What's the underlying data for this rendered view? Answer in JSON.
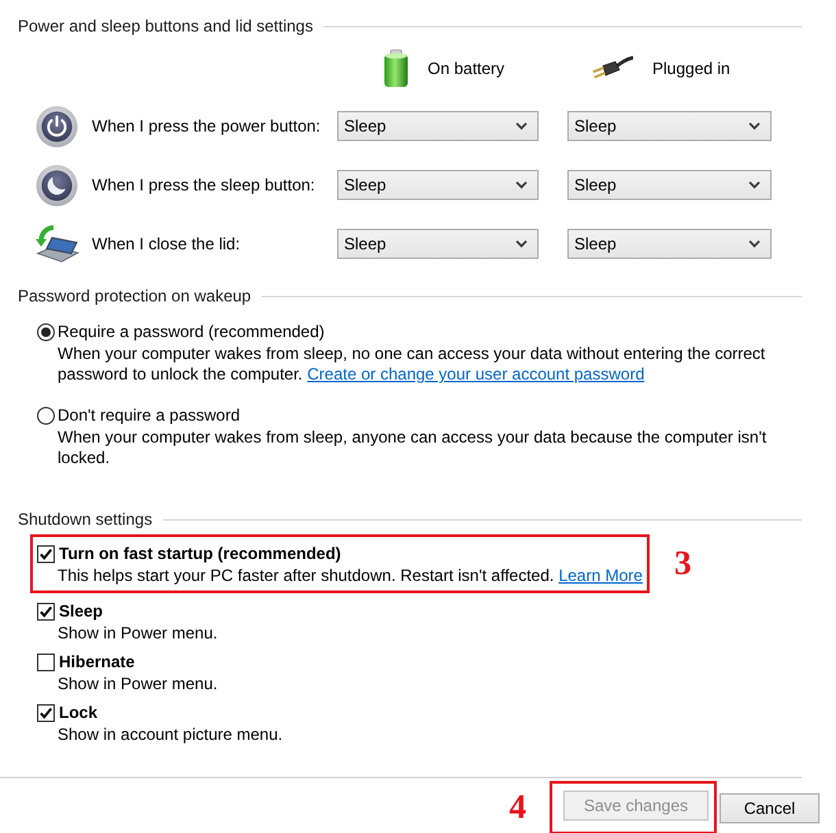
{
  "power_buttons_section": {
    "title": "Power and sleep buttons and lid settings",
    "columns": [
      {
        "kind": "battery",
        "label": "On battery"
      },
      {
        "kind": "plug",
        "label": "Plugged in"
      }
    ],
    "rows": [
      {
        "kind": "power",
        "label": "When I press the power button:",
        "values": [
          "Sleep",
          "Sleep"
        ]
      },
      {
        "kind": "sleep",
        "label": "When I press the sleep button:",
        "values": [
          "Sleep",
          "Sleep"
        ]
      },
      {
        "kind": "lid",
        "label": "When I close the lid:",
        "values": [
          "Sleep",
          "Sleep"
        ]
      }
    ]
  },
  "password_section": {
    "title": "Password protection on wakeup",
    "options": [
      {
        "label": "Require a password (recommended)",
        "selected": true,
        "description": "When your computer wakes from sleep, no one can access your data without entering the correct password to unlock the computer.",
        "link": "Create or change your user account password"
      },
      {
        "label": "Don't require a password",
        "selected": false,
        "description": "When your computer wakes from sleep, anyone can access your data because the computer isn't locked."
      }
    ]
  },
  "shutdown_section": {
    "title": "Shutdown settings",
    "options": [
      {
        "label": "Turn on fast startup (recommended)",
        "checked": true,
        "description": "This helps start your PC faster after shutdown. Restart isn't affected.",
        "link": "Learn More",
        "callout": "3"
      },
      {
        "label": "Sleep",
        "checked": true,
        "description": "Show in Power menu."
      },
      {
        "label": "Hibernate",
        "checked": false,
        "description": "Show in Power menu."
      },
      {
        "label": "Lock",
        "checked": true,
        "description": "Show in account picture menu."
      }
    ]
  },
  "footer": {
    "buttons": [
      {
        "kind": "save",
        "label": "Save changes",
        "disabled": true,
        "callout": "4"
      },
      {
        "kind": "cancel",
        "label": "Cancel",
        "disabled": false
      }
    ]
  }
}
